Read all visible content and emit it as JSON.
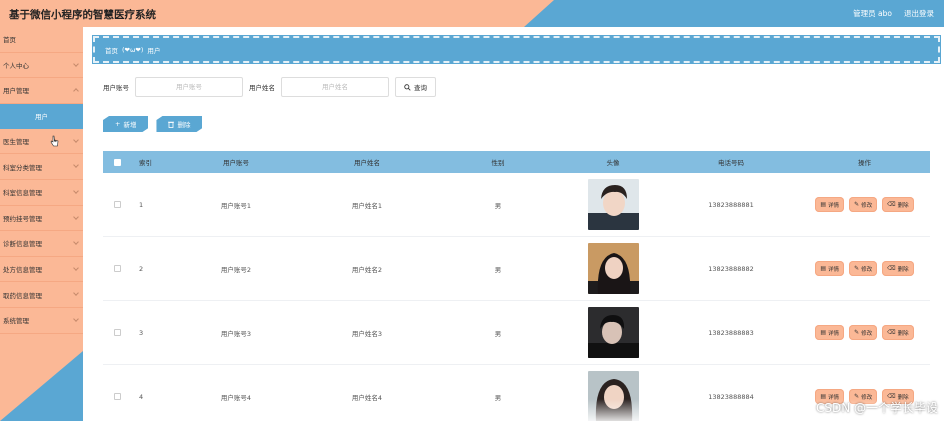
{
  "header": {
    "title": "基于微信小程序的智慧医疗系统",
    "user_label": "管理员 abo",
    "logout_label": "退出登录"
  },
  "sidebar": {
    "items": [
      {
        "label": "首页",
        "chevron": false
      },
      {
        "label": "个人中心",
        "chevron": true
      },
      {
        "label": "用户管理",
        "chevron": true,
        "open": true
      },
      {
        "label": "医生管理",
        "chevron": true
      },
      {
        "label": "科室分类管理",
        "chevron": true
      },
      {
        "label": "科室信息管理",
        "chevron": true
      },
      {
        "label": "预约挂号管理",
        "chevron": true
      },
      {
        "label": "诊断信息管理",
        "chevron": true
      },
      {
        "label": "处方信息管理",
        "chevron": true
      },
      {
        "label": "取药信息管理",
        "chevron": true
      },
      {
        "label": "系统管理",
        "chevron": true
      }
    ],
    "sub_item": "用户"
  },
  "breadcrumb": {
    "home": "首页",
    "separator": "(❤ω❤)",
    "current": "用户"
  },
  "search": {
    "account_label": "用户账号",
    "account_placeholder": "用户账号",
    "name_label": "用户姓名",
    "name_placeholder": "用户姓名",
    "query_label": "查询"
  },
  "actions": {
    "add_label": "新增",
    "delete_label": "删除"
  },
  "table": {
    "headers": {
      "index": "索引",
      "account": "用户账号",
      "name": "用户姓名",
      "sex": "性别",
      "avatar": "头像",
      "phone": "电话号码",
      "ops": "操作"
    },
    "op_labels": {
      "detail": "详情",
      "edit": "修改",
      "delete": "删除"
    },
    "rows": [
      {
        "index": "1",
        "account": "用户账号1",
        "name": "用户姓名1",
        "sex": "男",
        "phone": "13823888881"
      },
      {
        "index": "2",
        "account": "用户账号2",
        "name": "用户姓名2",
        "sex": "男",
        "phone": "13823888882"
      },
      {
        "index": "3",
        "account": "用户账号3",
        "name": "用户姓名3",
        "sex": "男",
        "phone": "13823888883"
      },
      {
        "index": "4",
        "account": "用户账号4",
        "name": "用户姓名4",
        "sex": "男",
        "phone": "13823888884"
      }
    ]
  },
  "watermark": "CSDN @一个学长毕设",
  "colors": {
    "peach": "#fbb896",
    "blue": "#5aa7d3",
    "table_header": "#83bde0"
  }
}
